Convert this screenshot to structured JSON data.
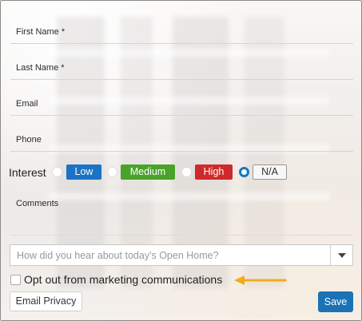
{
  "fields": [
    {
      "label": "First Name *"
    },
    {
      "label": "Last Name *"
    },
    {
      "label": "Email"
    },
    {
      "label": "Phone"
    }
  ],
  "interest": {
    "label": "Interest",
    "options": [
      {
        "label": "Low",
        "color": "#1a73c4",
        "selected": false
      },
      {
        "label": "Medium",
        "color": "#4aa329",
        "selected": false
      },
      {
        "label": "High",
        "color": "#d0292b",
        "selected": false
      },
      {
        "label": "N/A",
        "color": "#ffffff",
        "selected": true
      }
    ]
  },
  "comments": {
    "label": "Comments"
  },
  "source_select": {
    "placeholder": "How did you hear about today's Open Home?"
  },
  "opt_out": {
    "label": "Opt out from marketing communications",
    "checked": false
  },
  "annotation_arrow": {
    "color": "#f0ab1e",
    "icon": "arrow-left-icon"
  },
  "buttons": {
    "email_privacy": "Email Privacy",
    "save": "Save"
  }
}
